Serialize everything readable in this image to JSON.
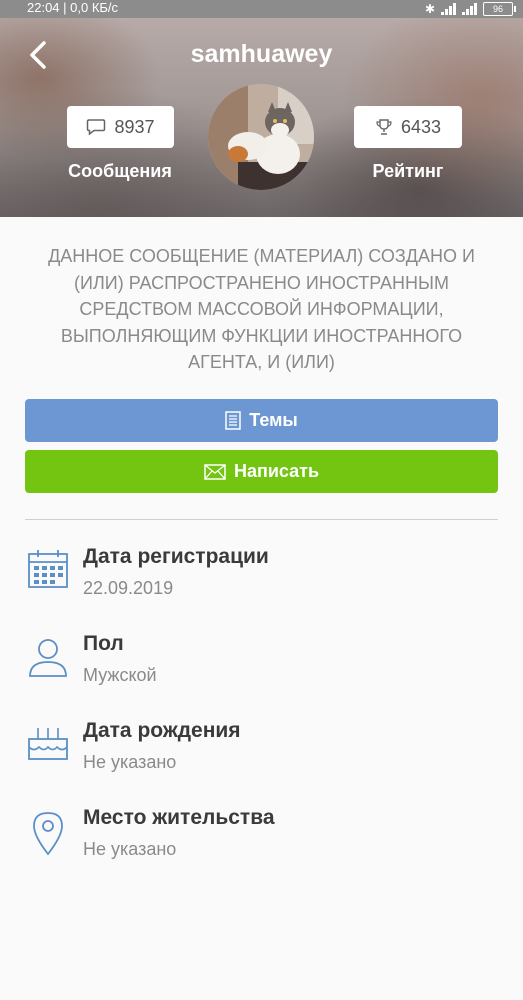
{
  "status_bar": {
    "time_speed": "22:04 | 0,0 КБ/с",
    "battery": "96"
  },
  "header": {
    "username": "samhuawey",
    "messages_count": "8937",
    "messages_label": "Сообщения",
    "rating_count": "6433",
    "rating_label": "Рейтинг"
  },
  "notice": {
    "text": "ДАННОЕ СООБЩЕНИЕ (МАТЕРИАЛ) СОЗДАНО И (ИЛИ) РАСПРОСТРАНЕНО ИНОСТРАННЫМ СРЕДСТВОМ МАССОВОЙ ИНФОРМАЦИИ, ВЫПОЛНЯЮЩИМ ФУНКЦИИ ИНОСТРАННОГО АГЕНТА, И (ИЛИ)"
  },
  "buttons": {
    "topics_label": "Темы",
    "write_label": "Написать"
  },
  "info": [
    {
      "title": "Дата регистрации",
      "value": "22.09.2019",
      "icon": "calendar-icon"
    },
    {
      "title": "Пол",
      "value": "Мужской",
      "icon": "person-icon"
    },
    {
      "title": "Дата рождения",
      "value": "Не указано",
      "icon": "cake-icon"
    },
    {
      "title": "Место жительства",
      "value": "Не указано",
      "icon": "location-pin-icon"
    }
  ],
  "colors": {
    "topics_button": "#6d97d2",
    "write_button": "#73c511",
    "icon_blue": "#5b8fc8"
  }
}
